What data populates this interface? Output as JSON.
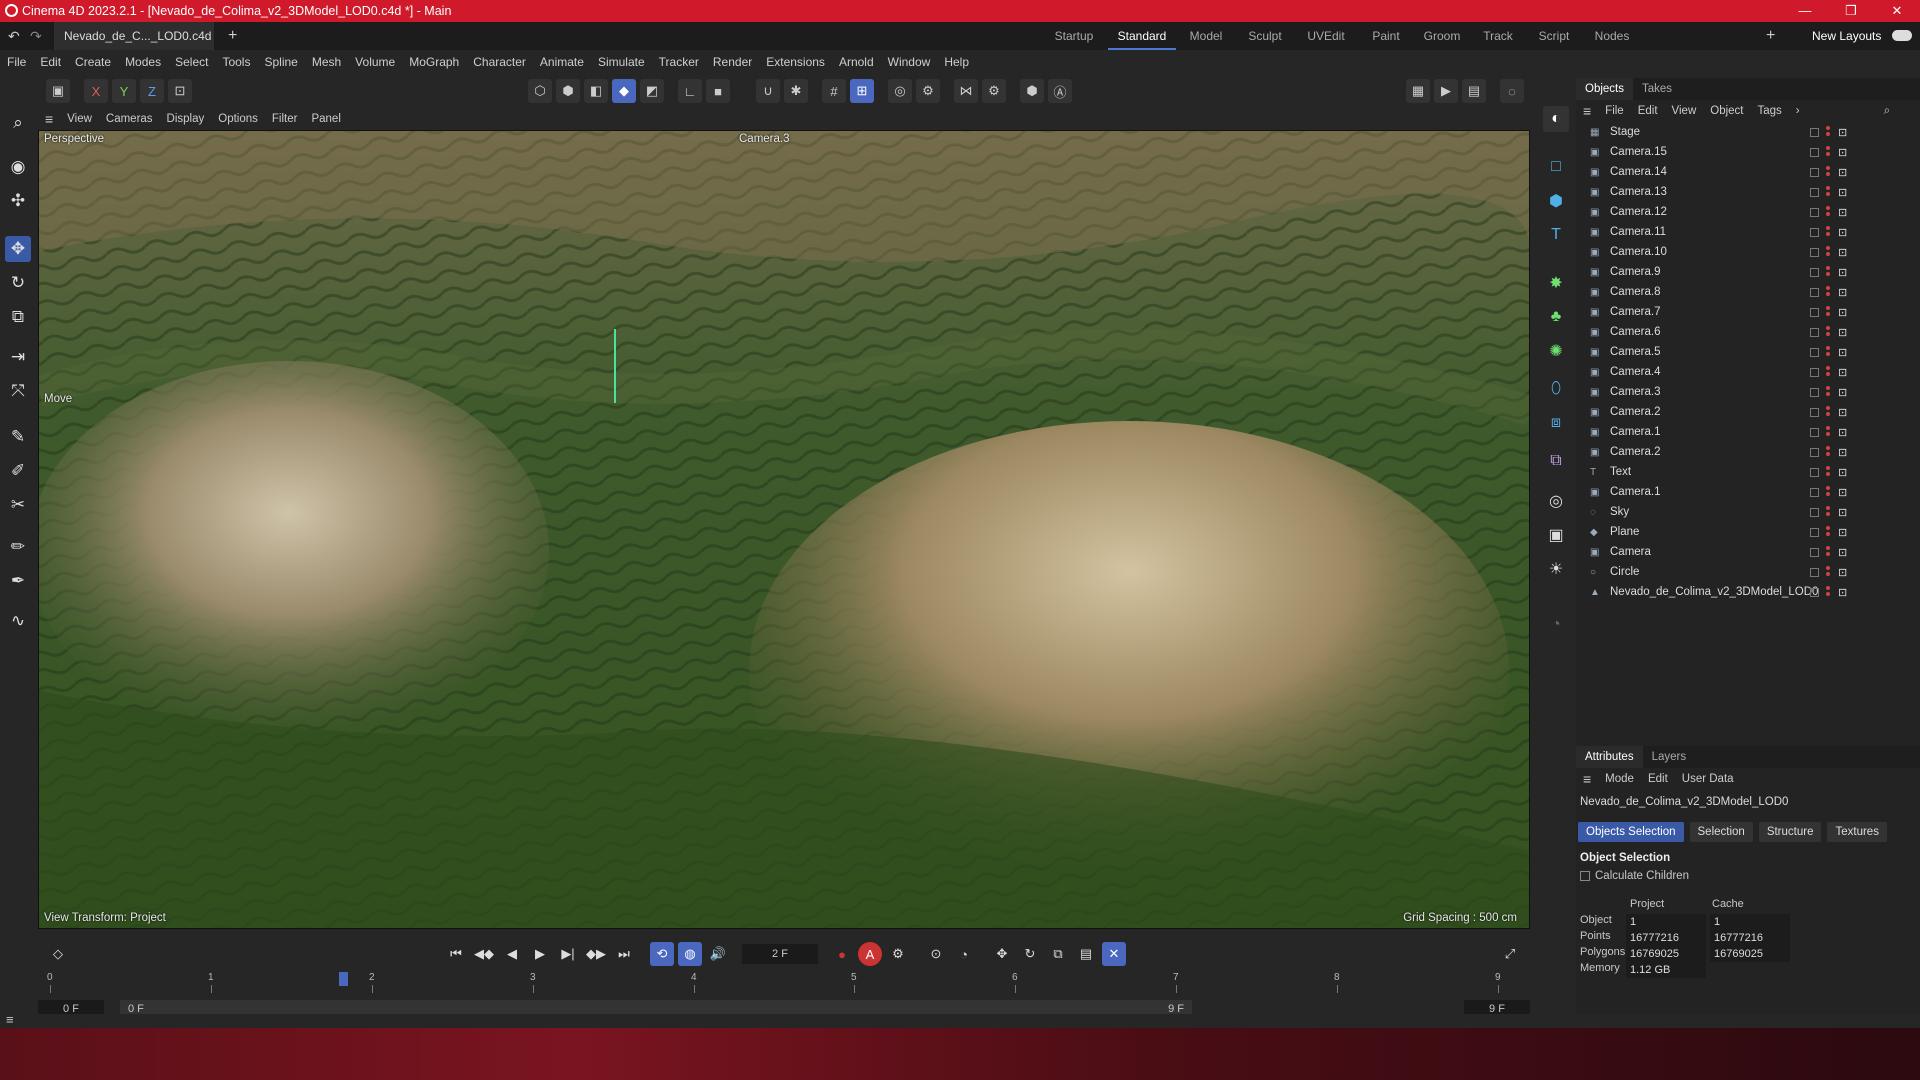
{
  "window": {
    "title": "Cinema 4D 2023.2.1 - [Nevado_de_Colima_v2_3DModel_LOD0.c4d *] - Main",
    "minimize": "—",
    "maximize": "❐",
    "close": "✕"
  },
  "doc_tab": {
    "label": "Nevado_de_C..._LOD0.c4d *",
    "close": "✕",
    "add": "+"
  },
  "layouts": {
    "items": [
      "Startup",
      "Standard",
      "Model",
      "Sculpt",
      "UVEdit",
      "Paint",
      "Groom",
      "Track",
      "Script",
      "Nodes"
    ],
    "active": "Standard",
    "add": "+",
    "new_layouts": "New Layouts"
  },
  "menu": [
    "File",
    "Edit",
    "Create",
    "Modes",
    "Select",
    "Tools",
    "Spline",
    "Mesh",
    "Volume",
    "MoGraph",
    "Character",
    "Animate",
    "Simulate",
    "Tracker",
    "Render",
    "Extensions",
    "Arnold",
    "Window",
    "Help"
  ],
  "axes": {
    "x": "X",
    "y": "Y",
    "z": "Z"
  },
  "viewport_menu": [
    "View",
    "Cameras",
    "Display",
    "Options",
    "Filter",
    "Panel"
  ],
  "viewport": {
    "view_name": "Perspective",
    "camera_name": "Camera.3",
    "tool_label": "Move",
    "view_transform": "View Transform: Project",
    "grid_spacing": "Grid Spacing : 500 cm"
  },
  "objects_panel": {
    "tabs": [
      "Objects",
      "Takes"
    ],
    "active_tab": "Objects",
    "menu": [
      "File",
      "Edit",
      "View",
      "Object",
      "Tags"
    ],
    "items": [
      {
        "name": "Stage",
        "icon": "stage-icon"
      },
      {
        "name": "Camera.15",
        "icon": "camera-icon"
      },
      {
        "name": "Camera.14",
        "icon": "camera-icon"
      },
      {
        "name": "Camera.13",
        "icon": "camera-icon"
      },
      {
        "name": "Camera.12",
        "icon": "camera-icon"
      },
      {
        "name": "Camera.11",
        "icon": "camera-icon"
      },
      {
        "name": "Camera.10",
        "icon": "camera-icon"
      },
      {
        "name": "Camera.9",
        "icon": "camera-icon"
      },
      {
        "name": "Camera.8",
        "icon": "camera-icon"
      },
      {
        "name": "Camera.7",
        "icon": "camera-icon"
      },
      {
        "name": "Camera.6",
        "icon": "camera-icon"
      },
      {
        "name": "Camera.5",
        "icon": "camera-icon"
      },
      {
        "name": "Camera.4",
        "icon": "camera-icon"
      },
      {
        "name": "Camera.3",
        "icon": "camera-icon"
      },
      {
        "name": "Camera.2",
        "icon": "camera-icon"
      },
      {
        "name": "Camera.1",
        "icon": "camera-icon"
      },
      {
        "name": "Camera.2",
        "icon": "camera-icon"
      },
      {
        "name": "Text",
        "icon": "text-icon"
      },
      {
        "name": "Camera.1",
        "icon": "camera-icon"
      },
      {
        "name": "Sky",
        "icon": "sky-icon"
      },
      {
        "name": "Plane",
        "icon": "plane-icon"
      },
      {
        "name": "Camera",
        "icon": "camera-icon"
      },
      {
        "name": "Circle",
        "icon": "circle-icon"
      },
      {
        "name": "Nevado_de_Colima_v2_3DModel_LOD0",
        "icon": "polygon-object-icon"
      }
    ]
  },
  "attributes_panel": {
    "tabs": [
      "Attributes",
      "Layers"
    ],
    "active_tab": "Attributes",
    "menu": [
      "Mode",
      "Edit",
      "User Data"
    ],
    "object_name": "Nevado_de_Colima_v2_3DModel_LOD0",
    "buttons": [
      "Objects Selection",
      "Selection",
      "Structure",
      "Textures"
    ],
    "active_button": "Objects Selection",
    "section_title": "Object Selection",
    "calculate_children": "Calculate Children",
    "col_project": "Project",
    "col_cache": "Cache",
    "rows": [
      {
        "label": "Object",
        "project": "1",
        "cache": "1"
      },
      {
        "label": "Points",
        "project": "16777216",
        "cache": "16777216"
      },
      {
        "label": "Polygons",
        "project": "16769025",
        "cache": "16769025"
      },
      {
        "label": "Memory",
        "project": "1.12 GB",
        "cache": ""
      }
    ]
  },
  "timeline": {
    "current_frame": "2 F",
    "ruler": [
      "0",
      "1",
      "2",
      "3",
      "4",
      "5",
      "6",
      "7",
      "8",
      "9"
    ],
    "current_marker": "2",
    "start_field": "0 F",
    "range_start": "0 F",
    "range_end": "9 F",
    "end_field": "9 F",
    "playhead_fraction": 0.222
  }
}
